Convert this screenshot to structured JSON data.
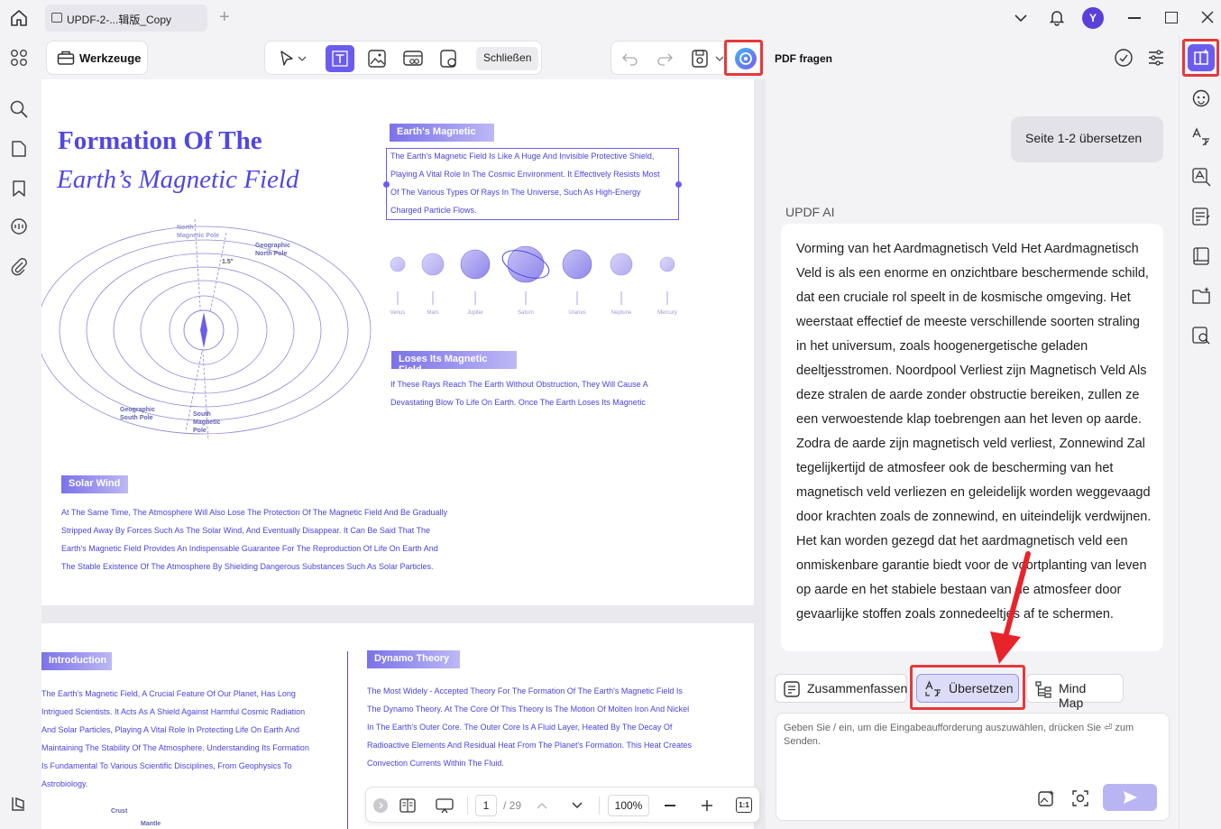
{
  "titlebar": {
    "tab_title": "UPDF-2-...辑版_Copy",
    "new_tab": "+",
    "avatar_letter": "Y"
  },
  "toolbar": {
    "tools_label": "Werkzeuge",
    "close_label": "Schließen"
  },
  "document": {
    "page1": {
      "title_line1": "Formation Of The",
      "title_line2": "Earth’s Magnetic Field",
      "section1_tag": "Earth's Magnetic",
      "section1_lines": [
        "The Earth's Magnetic Field Is Like A Huge And Invisible Protective Shield,",
        "Playing A Vital Role In The Cosmic Environment. It Effectively Resists Most",
        "Of The Various Types Of Rays In The Universe, Such As High-Energy",
        "Charged Particle Flows."
      ],
      "planets": [
        "Venus",
        "Mars",
        "Jupiter",
        "Saturn",
        "Uranus",
        "Neptune",
        "Mercury"
      ],
      "diagram_labels": {
        "north_magnetic_pole": "North Magnetic Pole",
        "geographic_north_pole": "Geographic North Pole",
        "geographic_south_pole": "Geographic South Pole",
        "south_magnetic_pole": "South Magnetic Pole",
        "angle": "1.5°"
      },
      "section2_tag": "Loses Its Magnetic Field",
      "section2_lines": [
        "If These Rays Reach The Earth Without Obstruction, They Will Cause A",
        "Devastating Blow To Life On Earth. Once The Earth Loses Its Magnetic"
      ],
      "section3_tag": "Solar Wind",
      "section3_lines": [
        "At The Same Time, The Atmosphere Will Also Lose The Protection Of The Magnetic Field And Be Gradually",
        "Stripped Away By Forces Such As The Solar Wind, And Eventually Disappear. It Can Be Said That The",
        "Earth's Magnetic Field Provides An Indispensable Guarantee For The Reproduction Of Life On Earth And",
        "The Stable Existence Of The Atmosphere By Shielding Dangerous Substances Such As Solar Particles."
      ]
    },
    "page2": {
      "intro_tag": "Introduction",
      "intro_lines": [
        "The Earth's Magnetic Field, A Crucial Feature Of Our Planet, Has Long",
        "Intrigued Scientists. It Acts As A Shield Against Harmful Cosmic Radiation",
        "And Solar Particles, Playing A Vital Role In Protecting Life On Earth And",
        "Maintaining The Stability Of The Atmosphere. Understanding Its Formation",
        "Is Fundamental To Various Scientific Disciplines, From Geophysics To",
        "Astrobiology."
      ],
      "dynamo_tag": "Dynamo Theory",
      "dynamo_lines": [
        "The Most Widely - Accepted Theory For The Formation Of The Earth's Magnetic Field Is",
        "The Dynamo Theory. At The Core Of This Theory Is The Motion Of Molten Iron And Nickel",
        "In The Earth's Outer Core. The Outer Core Is A Fluid Layer, Heated By The Decay Of",
        "Radioactive Elements And Residual Heat From The Planet's Formation. This Heat Creates",
        "Convection Currents Within The Fluid."
      ],
      "crust_label": "Crust",
      "mantle_label": "Mantle"
    }
  },
  "page_nav": {
    "current_page": "1",
    "total_pages": "/ 29",
    "zoom": "100%",
    "fit_label": "1:1"
  },
  "ai_panel": {
    "title": "PDF fragen",
    "user_message": "Seite 1-2 übersetzen",
    "ai_name": "UPDF AI",
    "ai_response": "Vorming van het Aardmagnetisch Veld Het Aardmagnetisch Veld is als een enorme en onzichtbare beschermende schild, dat een cruciale rol speelt in de kosmische omgeving. Het weerstaat effectief de meeste verschillende soorten straling in het universum, zoals hoogenergetische geladen deeltjesstromen. Noordpool Verliest zijn Magnetisch Veld Als deze stralen de aarde zonder obstructie bereiken, zullen ze een verwoestende klap toebrengen aan het leven op aarde. Zodra de aarde zijn magnetisch veld verliest, Zonnewind Zal tegelijkertijd de atmosfeer ook de bescherming van het magnetisch veld verliezen en geleidelijk worden weggevaagd door krachten zoals de zonnewind, en uiteindelijk verdwijnen. Het kan worden gezegd dat het aardmagnetisch veld een onmiskenbare garantie biedt voor de voortplanting van leven op aarde en het stabiele bestaan van de atmosfeer door gevaarlijke stoffen zoals zonnedeeltjes af te schermen.",
    "actions": {
      "summarize": "Zusammenfassen",
      "translate": "Übersetzen",
      "mindmap": "Mind Map"
    },
    "input_placeholder": "Geben Sie / ein, um die Eingabeaufforderung auszuwählen, drücken Sie ⏎ zum Senden."
  },
  "colors": {
    "accent": "#6b5cf0",
    "pdf_text": "#4a44d8",
    "highlight": "#e5393b"
  }
}
